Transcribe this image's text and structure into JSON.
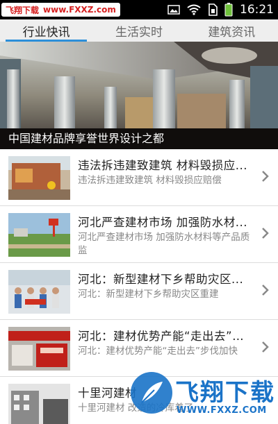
{
  "status_bar": {
    "watermark_text": "飞翔下载",
    "watermark_url": "www.FXXZ.com",
    "time": "16:21",
    "icons": [
      "image-icon",
      "wifi-icon",
      "sim-icon",
      "battery-icon"
    ]
  },
  "tabs": [
    {
      "label": "行业快讯",
      "active": true
    },
    {
      "label": "生活实时",
      "active": false
    },
    {
      "label": "建筑资讯",
      "active": false
    }
  ],
  "banner": {
    "caption": "中国建材品牌享誉世界设计之都"
  },
  "news": [
    {
      "title": "违法拆违建致建筑 材料毁损应...",
      "summary": "违法拆违建致建筑 材料毁损应赔偿"
    },
    {
      "title": "河北严查建材市场 加强防水材...",
      "summary": "河北严查建材市场 加强防水材料等产品质监"
    },
    {
      "title": "河北：新型建材下乡帮助灾区...",
      "summary": "河北：新型建材下乡帮助灾区重建"
    },
    {
      "title": "河北：建材优势产能“走出去”步...",
      "summary": "河北：建材优势产能“走出去”步伐加快"
    },
    {
      "title": "十里河建材",
      "summary": "十里河建材 改造的冷库着了"
    }
  ],
  "watermark_bottom": {
    "title": "飞翔下载",
    "url": "WWW.FXXZ.COM"
  },
  "colors": {
    "accent": "#2c8fd9",
    "watermark_blue": "#1a73c8",
    "watermark_red": "#d61f1f"
  }
}
